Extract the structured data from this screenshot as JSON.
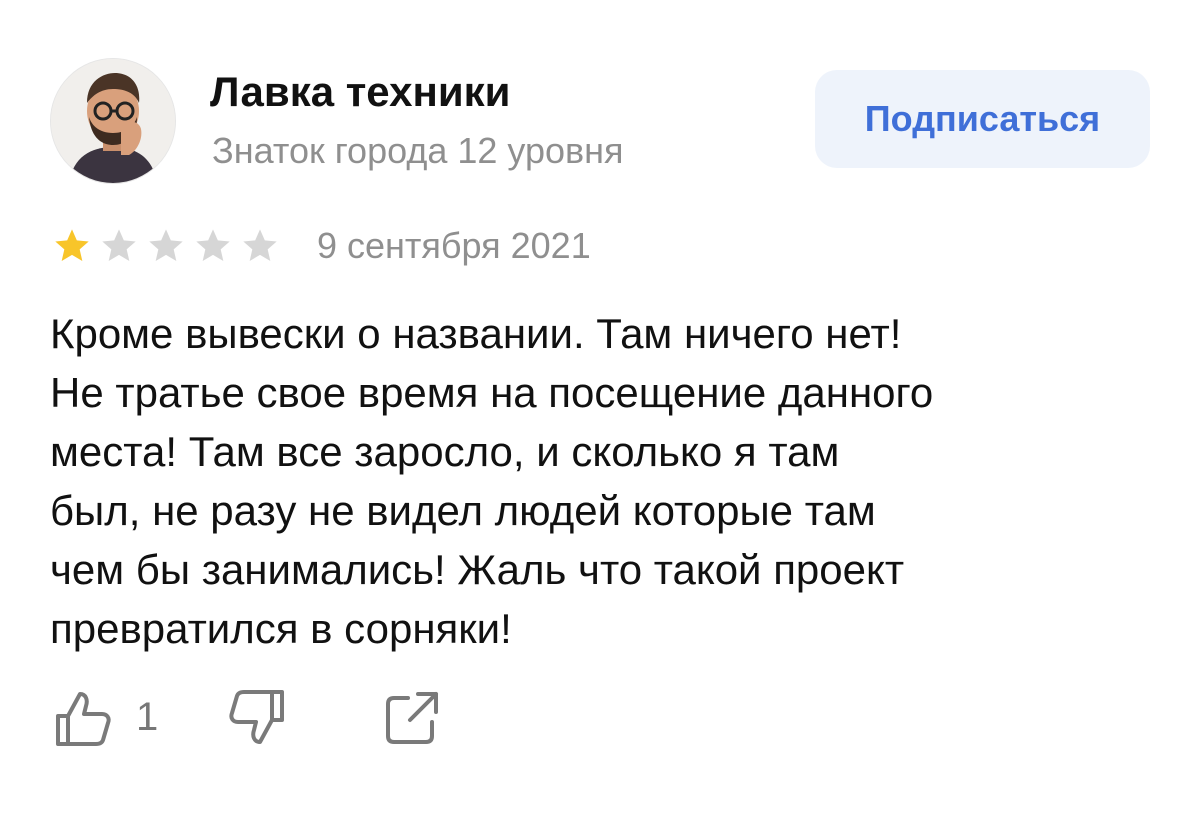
{
  "author": {
    "name": "Лавка техники",
    "level": "Знаток города 12 уровня",
    "avatar_icon": "avatar-man-with-glasses-icon"
  },
  "subscribe": {
    "label": "Подписаться"
  },
  "rating": {
    "value": 1,
    "max": 5,
    "filled_color": "#f8c52a",
    "empty_color": "#d6d6d6"
  },
  "review": {
    "date": "9 сентября 2021",
    "lines": [
      "Кроме вывески о названии. Там ничего нет!",
      "Не тратье свое время на посещение данного",
      "места! Там все заросло, и сколько я там",
      "был, не разу не видел людей которые там",
      "чем бы занимались! Жаль что такой проект",
      "превратился в сорняки!"
    ]
  },
  "actions": {
    "like_count": "1",
    "like_icon": "thumbs-up-icon",
    "dislike_icon": "thumbs-down-icon",
    "share_icon": "share-icon"
  },
  "colors": {
    "accent": "#3f6fd8",
    "button_bg": "#eef3fb",
    "secondary_text": "#8f8f8f"
  }
}
